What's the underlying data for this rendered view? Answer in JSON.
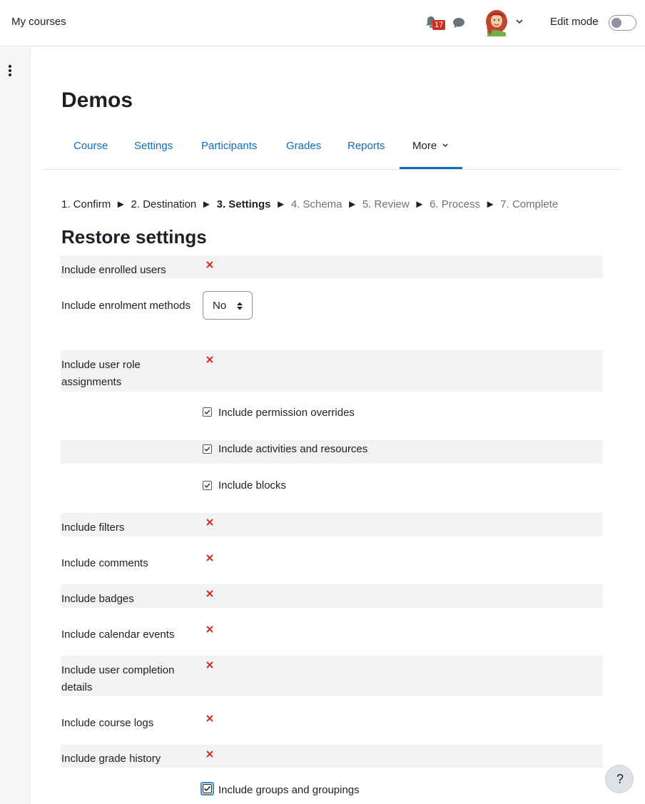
{
  "navbar": {
    "my_courses": "My courses",
    "notification_count": "17",
    "edit_mode_label": "Edit mode"
  },
  "page": {
    "title": "Demos"
  },
  "tabs": [
    {
      "label": "Course"
    },
    {
      "label": "Settings"
    },
    {
      "label": "Participants"
    },
    {
      "label": "Grades"
    },
    {
      "label": "Reports"
    },
    {
      "label": "More"
    }
  ],
  "progress": {
    "steps": [
      {
        "label": "1. Confirm",
        "state": "done"
      },
      {
        "label": "2. Destination",
        "state": "done"
      },
      {
        "label": "3. Settings",
        "state": "current"
      },
      {
        "label": "4. Schema",
        "state": "future"
      },
      {
        "label": "5. Review",
        "state": "future"
      },
      {
        "label": "6. Process",
        "state": "future"
      },
      {
        "label": "7. Complete",
        "state": "future"
      }
    ],
    "separator": "►"
  },
  "restore": {
    "title": "Restore settings",
    "enrolled_users": "Include enrolled users",
    "enrolment_methods": "Include enrolment methods",
    "enrolment_methods_value": "No",
    "role_assignments": "Include user role assignments",
    "permission_overrides": "Include permission overrides",
    "activities": "Include activities and resources",
    "blocks": "Include blocks",
    "filters": "Include filters",
    "comments": "Include comments",
    "badges": "Include badges",
    "calendar": "Include calendar events",
    "completion": "Include user completion details",
    "logs": "Include course logs",
    "grade_history": "Include grade history",
    "groups": "Include groups and groupings"
  },
  "help": {
    "label": "?"
  },
  "colors": {
    "link": "#0f6cbf",
    "disabled_x": "#ca3120",
    "shaded_row": "#f2f2f2"
  }
}
